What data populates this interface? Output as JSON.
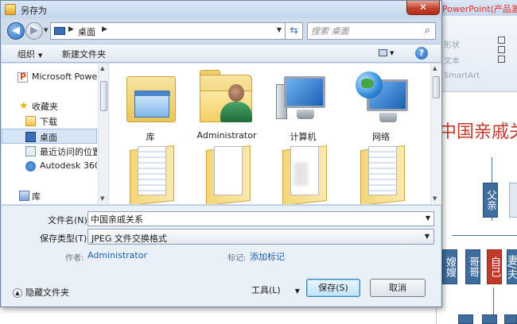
{
  "dialog": {
    "title": "另存为",
    "close_label": "✕"
  },
  "address": {
    "crumb": "桌面",
    "separator": "▶"
  },
  "search": {
    "placeholder": "搜索 桌面"
  },
  "toolbar": {
    "organize_label": "组织",
    "new_folder_label": "新建文件夹",
    "help_label": "?"
  },
  "nav": {
    "items": [
      {
        "label": "Microsoft PowerPoint",
        "icon": "powerpoint-icon"
      },
      {
        "label": "收藏夹",
        "icon": "star-icon"
      },
      {
        "label": "下载",
        "icon": "folder-icon"
      },
      {
        "label": "桌面",
        "icon": "desktop-icon",
        "selected": true
      },
      {
        "label": "最近访问的位置",
        "icon": "recent-icon"
      },
      {
        "label": "Autodesk 360",
        "icon": "cloud-icon"
      },
      {
        "label": "库",
        "icon": "library-icon"
      }
    ]
  },
  "files": [
    {
      "name": "库",
      "icon": "library-folder-icon"
    },
    {
      "name": "Administrator",
      "icon": "user-folder-icon"
    },
    {
      "name": "计算机",
      "icon": "computer-icon"
    },
    {
      "name": "网络",
      "icon": "network-icon"
    },
    {
      "name": "",
      "icon": "open-folder-icon"
    },
    {
      "name": "",
      "icon": "open-folder-icon"
    },
    {
      "name": "",
      "icon": "open-folder-icon"
    },
    {
      "name": "",
      "icon": "open-folder-icon"
    }
  ],
  "form": {
    "filename_label": "文件名(N):",
    "filename_value": "中国亲戚关系",
    "type_label": "保存类型(T):",
    "type_value": "JPEG 文件交换格式",
    "author_label": "作者:",
    "author_value": "Administrator",
    "tags_label": "标记:",
    "tags_value": "添加标记"
  },
  "buttons": {
    "hide_folders": "隐藏文件夹",
    "tools": "工具(L)",
    "save": "保存(S)",
    "cancel": "取消"
  },
  "background": {
    "app_title": "PowerPoint(产品激活",
    "ribbon_labels": [
      "形状",
      "文本",
      "SmartArt"
    ],
    "slide_title": "中国亲戚关",
    "nodes": [
      "父亲",
      "嫂嫂",
      "哥哥",
      "自己",
      "妻/夫"
    ]
  }
}
